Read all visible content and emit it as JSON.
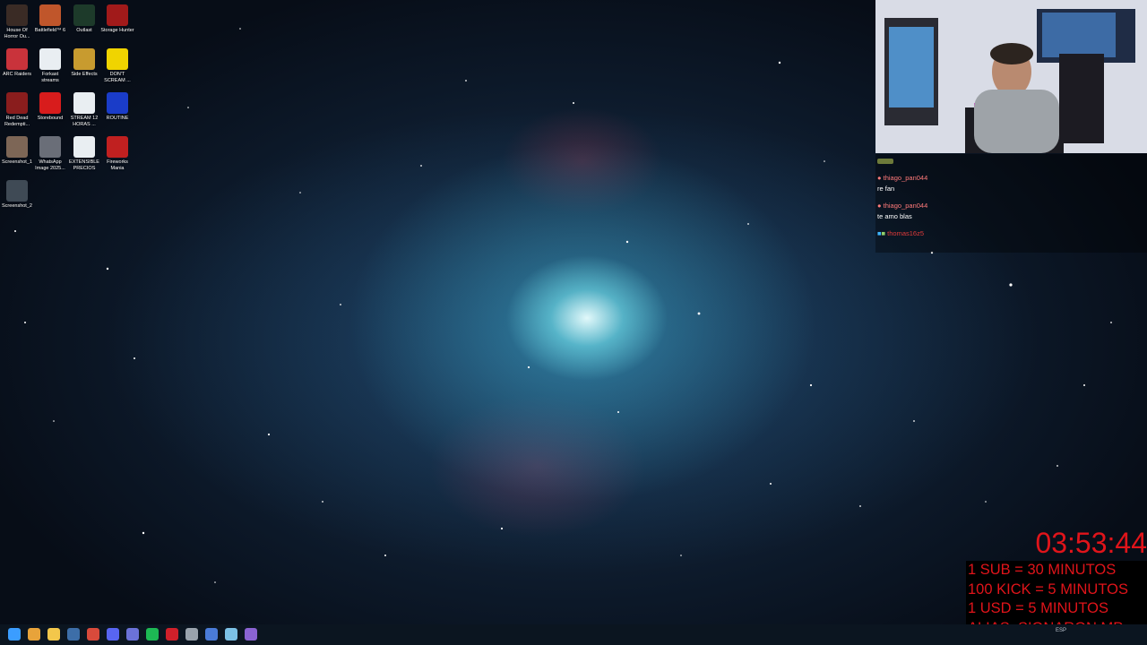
{
  "desktop": {
    "icons": [
      {
        "label": "House Of Horror Ou...",
        "icon": "house-of-horror-icon",
        "color": "#3a2b25"
      },
      {
        "label": "Battlefield™ 6",
        "icon": "battlefield-icon",
        "color": "#c0562b"
      },
      {
        "label": "Outlast",
        "icon": "outlast-icon",
        "color": "#1d3a2a"
      },
      {
        "label": "Storage Hunter",
        "icon": "storage-hunter-icon",
        "color": "#a11a1a"
      },
      {
        "label": "ARC Raiders",
        "icon": "arc-raiders-icon",
        "color": "#c9333b"
      },
      {
        "label": "Forkast streams",
        "icon": "document-icon",
        "color": "#e9eef2"
      },
      {
        "label": "Side Effects",
        "icon": "side-effects-icon",
        "color": "#c89b2f"
      },
      {
        "label": "DON'T SCREAM ...",
        "icon": "dont-scream-icon",
        "color": "#f0d400"
      },
      {
        "label": "Red Dead Redempti...",
        "icon": "red-dead-icon",
        "color": "#8a1d1d"
      },
      {
        "label": "Storebound",
        "icon": "storebound-icon",
        "color": "#d81c1c"
      },
      {
        "label": "STREAM 12 HORAS ...",
        "icon": "document-icon",
        "color": "#e9eef2"
      },
      {
        "label": "ROUTINE",
        "icon": "routine-icon",
        "color": "#1a3cc8"
      },
      {
        "label": "Screenshot_1",
        "icon": "image-icon",
        "color": "#7d6656"
      },
      {
        "label": "WhatsApp Image 2025...",
        "icon": "image-icon",
        "color": "#6a6e78"
      },
      {
        "label": "EXTENSIBLE PRECIOS",
        "icon": "document-icon",
        "color": "#e9eef2"
      },
      {
        "label": "Fireworks Mania",
        "icon": "fireworks-mania-icon",
        "color": "#c02020"
      },
      {
        "label": "Screenshot_2",
        "icon": "image-icon",
        "color": "#3f4a55"
      }
    ]
  },
  "chat": {
    "messages": [
      {
        "user": "thiago_pan044",
        "text": "re fan"
      },
      {
        "user": "thiago_pan044",
        "text": "te amo blas"
      },
      {
        "user": "thomas16z5",
        "text": ""
      }
    ]
  },
  "overlay": {
    "timer": "03:53:44",
    "rules": [
      "1 SUB = 30 MINUTOS",
      "100 KICK = 5 MINUTOS",
      "1 USD = 5 MINUTOS",
      "ALIAS: SIONARON.MP"
    ],
    "timer_color": "#e0141a"
  },
  "taskbar": {
    "apps": [
      {
        "name": "start-button",
        "color": "#3b9dff"
      },
      {
        "name": "chrome-icon",
        "color": "#e8a33a"
      },
      {
        "name": "file-explorer-icon",
        "color": "#f3c74b"
      },
      {
        "name": "steam-icon",
        "color": "#3d6ea8"
      },
      {
        "name": "chrome-alt-icon",
        "color": "#d84a3b"
      },
      {
        "name": "discord-icon",
        "color": "#5865f2"
      },
      {
        "name": "messenger-icon",
        "color": "#6b72d8"
      },
      {
        "name": "spotify-icon",
        "color": "#1db954"
      },
      {
        "name": "app-red-icon",
        "color": "#d0202a"
      },
      {
        "name": "app-gray-icon",
        "color": "#9aa3ad"
      },
      {
        "name": "app-blue-icon",
        "color": "#4a7bd8"
      },
      {
        "name": "network-tool-icon",
        "color": "#7cc1e6"
      },
      {
        "name": "twitch-like-icon",
        "color": "#8a63d2"
      }
    ],
    "tray_language": "ESP"
  }
}
